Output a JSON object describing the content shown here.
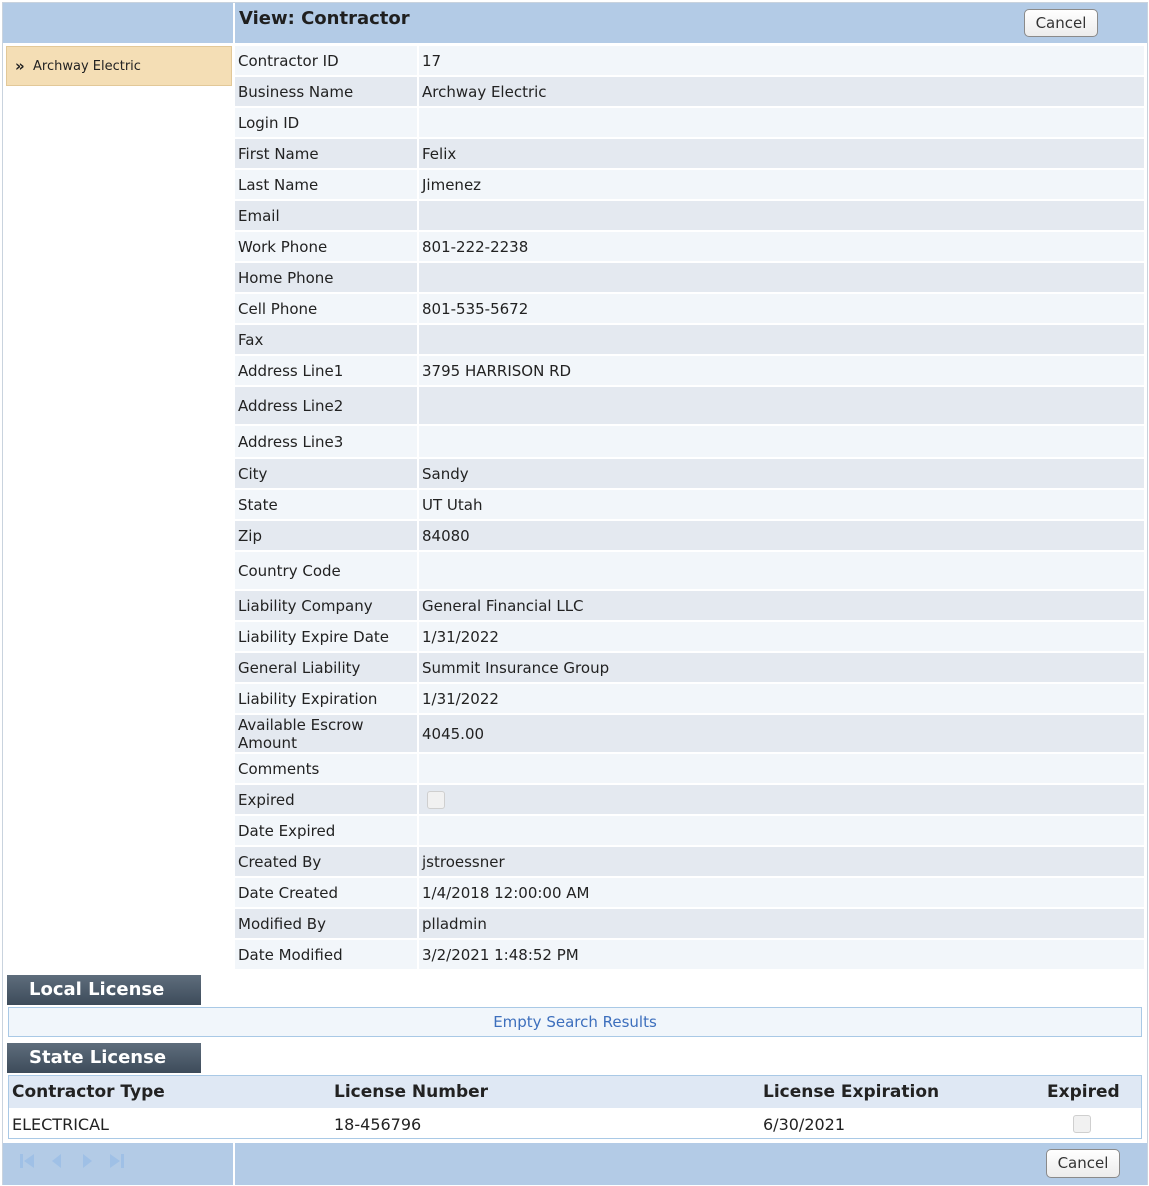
{
  "header": {
    "title": "View: Contractor",
    "cancel_label": "Cancel"
  },
  "sidebar": {
    "items": [
      {
        "label": "Archway Electric",
        "chevron": "»"
      }
    ]
  },
  "details": {
    "contractor_id": {
      "label": "Contractor ID",
      "value": "17"
    },
    "business_name": {
      "label": "Business Name",
      "value": "Archway Electric"
    },
    "login_id": {
      "label": "Login ID",
      "value": ""
    },
    "first_name": {
      "label": "First Name",
      "value": "Felix"
    },
    "last_name": {
      "label": "Last Name",
      "value": "Jimenez"
    },
    "email": {
      "label": "Email",
      "value": ""
    },
    "work_phone": {
      "label": "Work Phone",
      "value": "801-222-2238"
    },
    "home_phone": {
      "label": "Home Phone",
      "value": ""
    },
    "cell_phone": {
      "label": "Cell Phone",
      "value": "801-535-5672"
    },
    "fax": {
      "label": "Fax",
      "value": ""
    },
    "address1": {
      "label": "Address Line1",
      "value": "3795 HARRISON RD"
    },
    "address2": {
      "label": "Address Line2",
      "value": ""
    },
    "address3": {
      "label": "Address Line3",
      "value": ""
    },
    "city": {
      "label": "City",
      "value": "Sandy"
    },
    "state": {
      "label": "State",
      "value": "UT Utah"
    },
    "zip": {
      "label": "Zip",
      "value": "84080"
    },
    "country_code": {
      "label": "Country Code",
      "value": ""
    },
    "liability_company": {
      "label": "Liability Company",
      "value": "General Financial LLC"
    },
    "liability_expire_date": {
      "label": "Liability Expire Date",
      "value": "1/31/2022"
    },
    "general_liability": {
      "label": "General Liability",
      "value": "Summit Insurance Group"
    },
    "liability_expiration": {
      "label": "Liability Expiration",
      "value": "1/31/2022"
    },
    "escrow_amount": {
      "label": "Available Escrow Amount",
      "value": "4045.00"
    },
    "comments": {
      "label": "Comments",
      "value": ""
    },
    "expired": {
      "label": "Expired",
      "checked": false
    },
    "date_expired": {
      "label": "Date Expired",
      "value": ""
    },
    "created_by": {
      "label": "Created By",
      "value": "jstroessner"
    },
    "date_created": {
      "label": "Date Created",
      "value": "1/4/2018 12:00:00 AM"
    },
    "modified_by": {
      "label": "Modified By",
      "value": "plladmin"
    },
    "date_modified": {
      "label": "Date Modified",
      "value": "3/2/2021 1:48:52 PM"
    }
  },
  "local_license": {
    "title": "Local License",
    "empty_text": "Empty Search Results"
  },
  "state_license": {
    "title": "State License",
    "columns": [
      "Contractor Type",
      "License Number",
      "License Expiration",
      "Expired"
    ],
    "rows": [
      {
        "contractor_type": "ELECTRICAL",
        "license_number": "18-456796",
        "license_expiration": "6/30/2021",
        "expired": false
      }
    ]
  },
  "footer": {
    "cancel_label": "Cancel",
    "pager_icons": [
      "first-page-icon",
      "previous-page-icon",
      "next-page-icon",
      "last-page-icon"
    ]
  },
  "colors": {
    "header_bar": "#b3cbe6",
    "sidebar_selected": "#f4deb5",
    "section_header": "#4a5867",
    "row_odd": "#f2f6fa",
    "row_even": "#e4e9f0",
    "link_blue": "#3d6fbd"
  }
}
